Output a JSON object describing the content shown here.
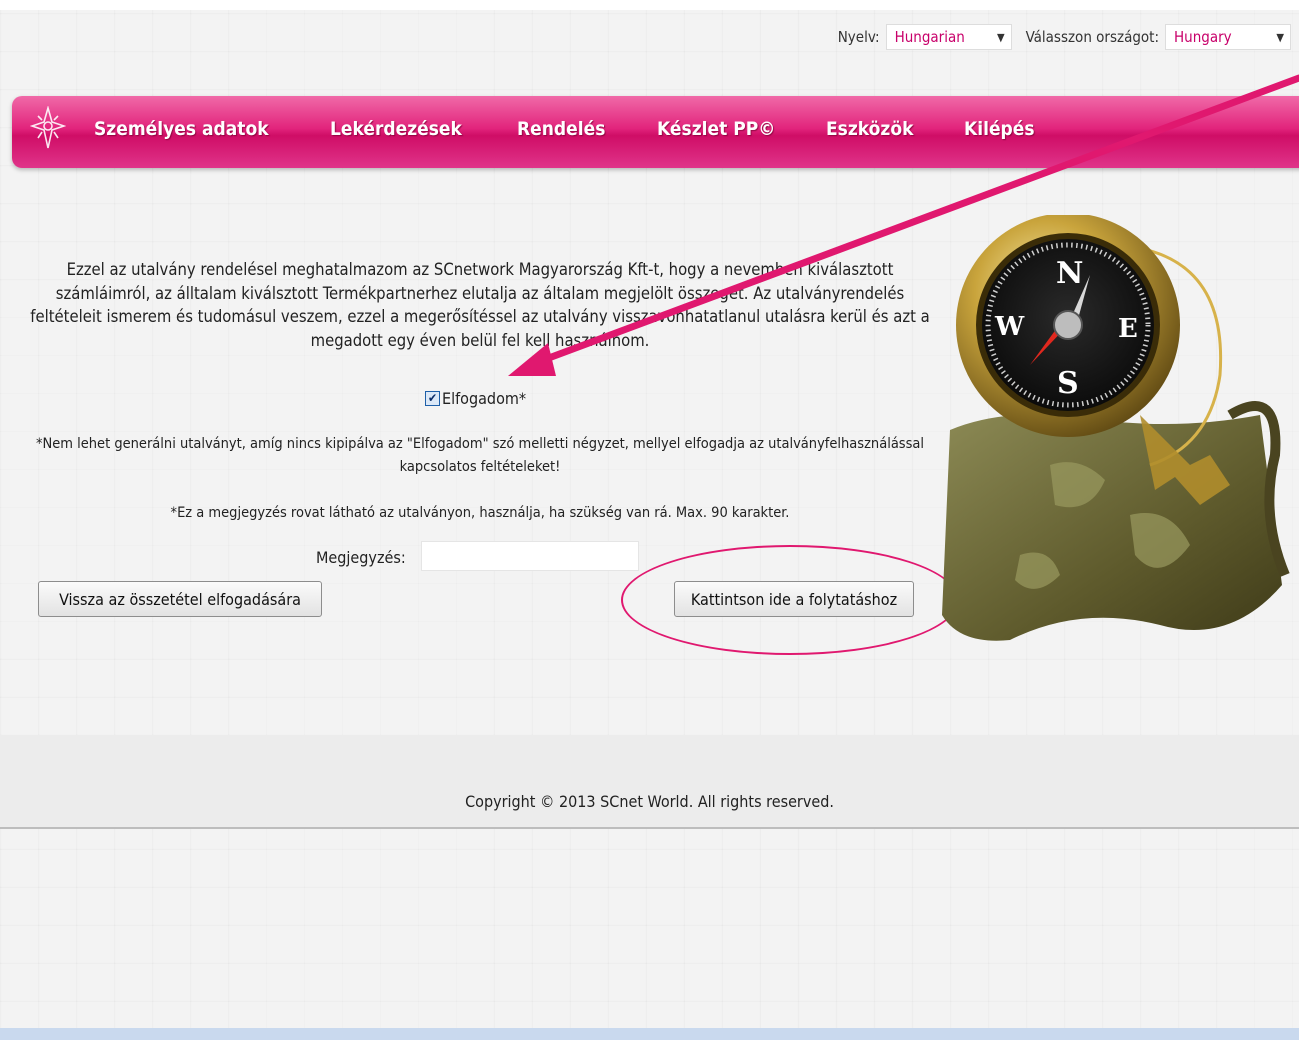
{
  "language_bar": {
    "language_label": "Nyelv:",
    "language_value": "Hungarian",
    "country_label": "Válasszon országot:",
    "country_value": "Hungary"
  },
  "nav": {
    "items": [
      "Személyes adatok",
      "Lekérdezések",
      "Rendelés",
      "Készlet PP©",
      "Eszközök",
      "Kilépés"
    ]
  },
  "content": {
    "paragraph": "Ezzel az utalvány rendelésel meghatalmazom az SCnetwork Magyarország Kft-t, hogy a nevemben kiválasztott számláimról, az álltalam kiválsztott Termékpartnerhez elutalja az általam megjelölt összeget. Az utalványrendelés feltételeit ismerem és tudomásul veszem, ezzel a megerősítéssel az utalvány visszavonhatatlanul utalásra kerül és azt a megadott egy éven belül fel kell használnom.",
    "accept_label": "Elfogadom*",
    "accept_checked": true,
    "note_accept": "*Nem lehet generálni utalványt, amíg nincs kipipálva az \"Elfogadom\" szó melletti négyzet, mellyel elfogadja az utalványfelhasználással kapcsolatos feltételeket!",
    "note_remark": "*Ez a megjegyzés rovat látható az utalványon, használja, ha szükség van rá. Max. 90 karakter.",
    "remark_label": "Megjegyzés:",
    "remark_value": "",
    "back_button": "Vissza az összetétel elfogadására",
    "continue_button": "Kattintson ide a folytatáshoz"
  },
  "footer": {
    "copyright": "Copyright © 2013 SCnet World. All rights reserved."
  },
  "colors": {
    "accent": "#e0186f",
    "nav_pink": "#d9156f",
    "select_text": "#c8006a"
  },
  "icons": [
    "logo-star-icon",
    "compass-map-illustration",
    "dropdown-arrow-icon",
    "annotation-arrow"
  ]
}
